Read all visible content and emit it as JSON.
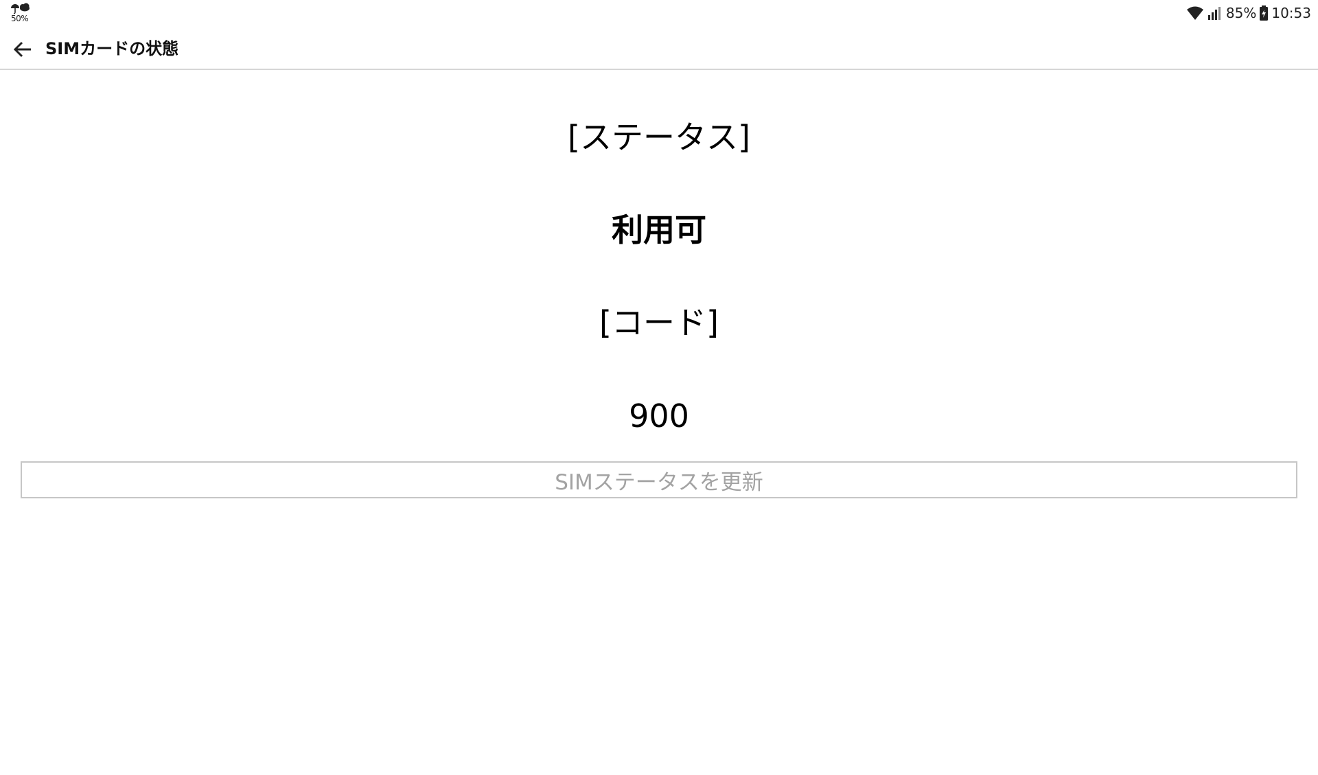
{
  "status_bar": {
    "weather_icon": "umbrella-cloud-icon",
    "weather_text": "50%",
    "wifi_icon": "wifi-icon",
    "signal_icon": "cell-signal-icon",
    "battery_percent": "85%",
    "battery_icon": "battery-charging-icon",
    "time": "10:53"
  },
  "app_bar": {
    "back_icon": "arrow-back-icon",
    "title": "SIMカードの状態"
  },
  "content": {
    "status_heading": "[ステータス]",
    "status_value": "利用可",
    "code_heading": "[コード]",
    "code_value": "900"
  },
  "actions": {
    "refresh_label": "SIMステータスを更新"
  },
  "colors": {
    "divider": "#d6d6d6",
    "button_border": "#c6c6c6",
    "button_text": "#a3a3a3"
  }
}
